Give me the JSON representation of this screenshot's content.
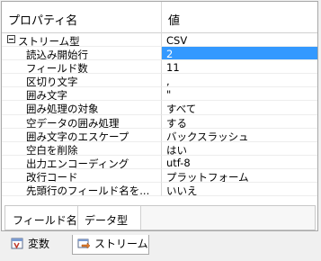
{
  "header": {
    "col_name": "プロパティ名",
    "col_value": "値"
  },
  "properties": [
    {
      "name": "ストリーム型",
      "value": "CSV",
      "category": true
    },
    {
      "name": "読込み開始行",
      "value": "2",
      "selected": true
    },
    {
      "name": "フィールド数",
      "value": "11"
    },
    {
      "name": "区切り文字",
      "value": ","
    },
    {
      "name": "囲み文字",
      "value": "\""
    },
    {
      "name": "囲み処理の対象",
      "value": "すべて"
    },
    {
      "name": "空データの囲み処理",
      "value": "する"
    },
    {
      "name": "囲み文字のエスケープ",
      "value": "バックスラッシュ"
    },
    {
      "name": "空白を削除",
      "value": "はい"
    },
    {
      "name": "出力エンコーディング",
      "value": "utf-8"
    },
    {
      "name": "改行コード",
      "value": "プラットフォーム"
    },
    {
      "name": "先頭行のフィールド名を...",
      "value": "いいえ"
    }
  ],
  "fields_table": {
    "col_field_name": "フィールド名",
    "col_data_type": "データ型"
  },
  "tabs": [
    {
      "label": "変数",
      "icon": "variables-icon",
      "active": false
    },
    {
      "label": "ストリーム",
      "icon": "stream-icon",
      "active": true
    }
  ],
  "colors": {
    "selection": "#3399ff",
    "panel_bg": "#ffffff",
    "window_bg": "#f0f0f0"
  }
}
